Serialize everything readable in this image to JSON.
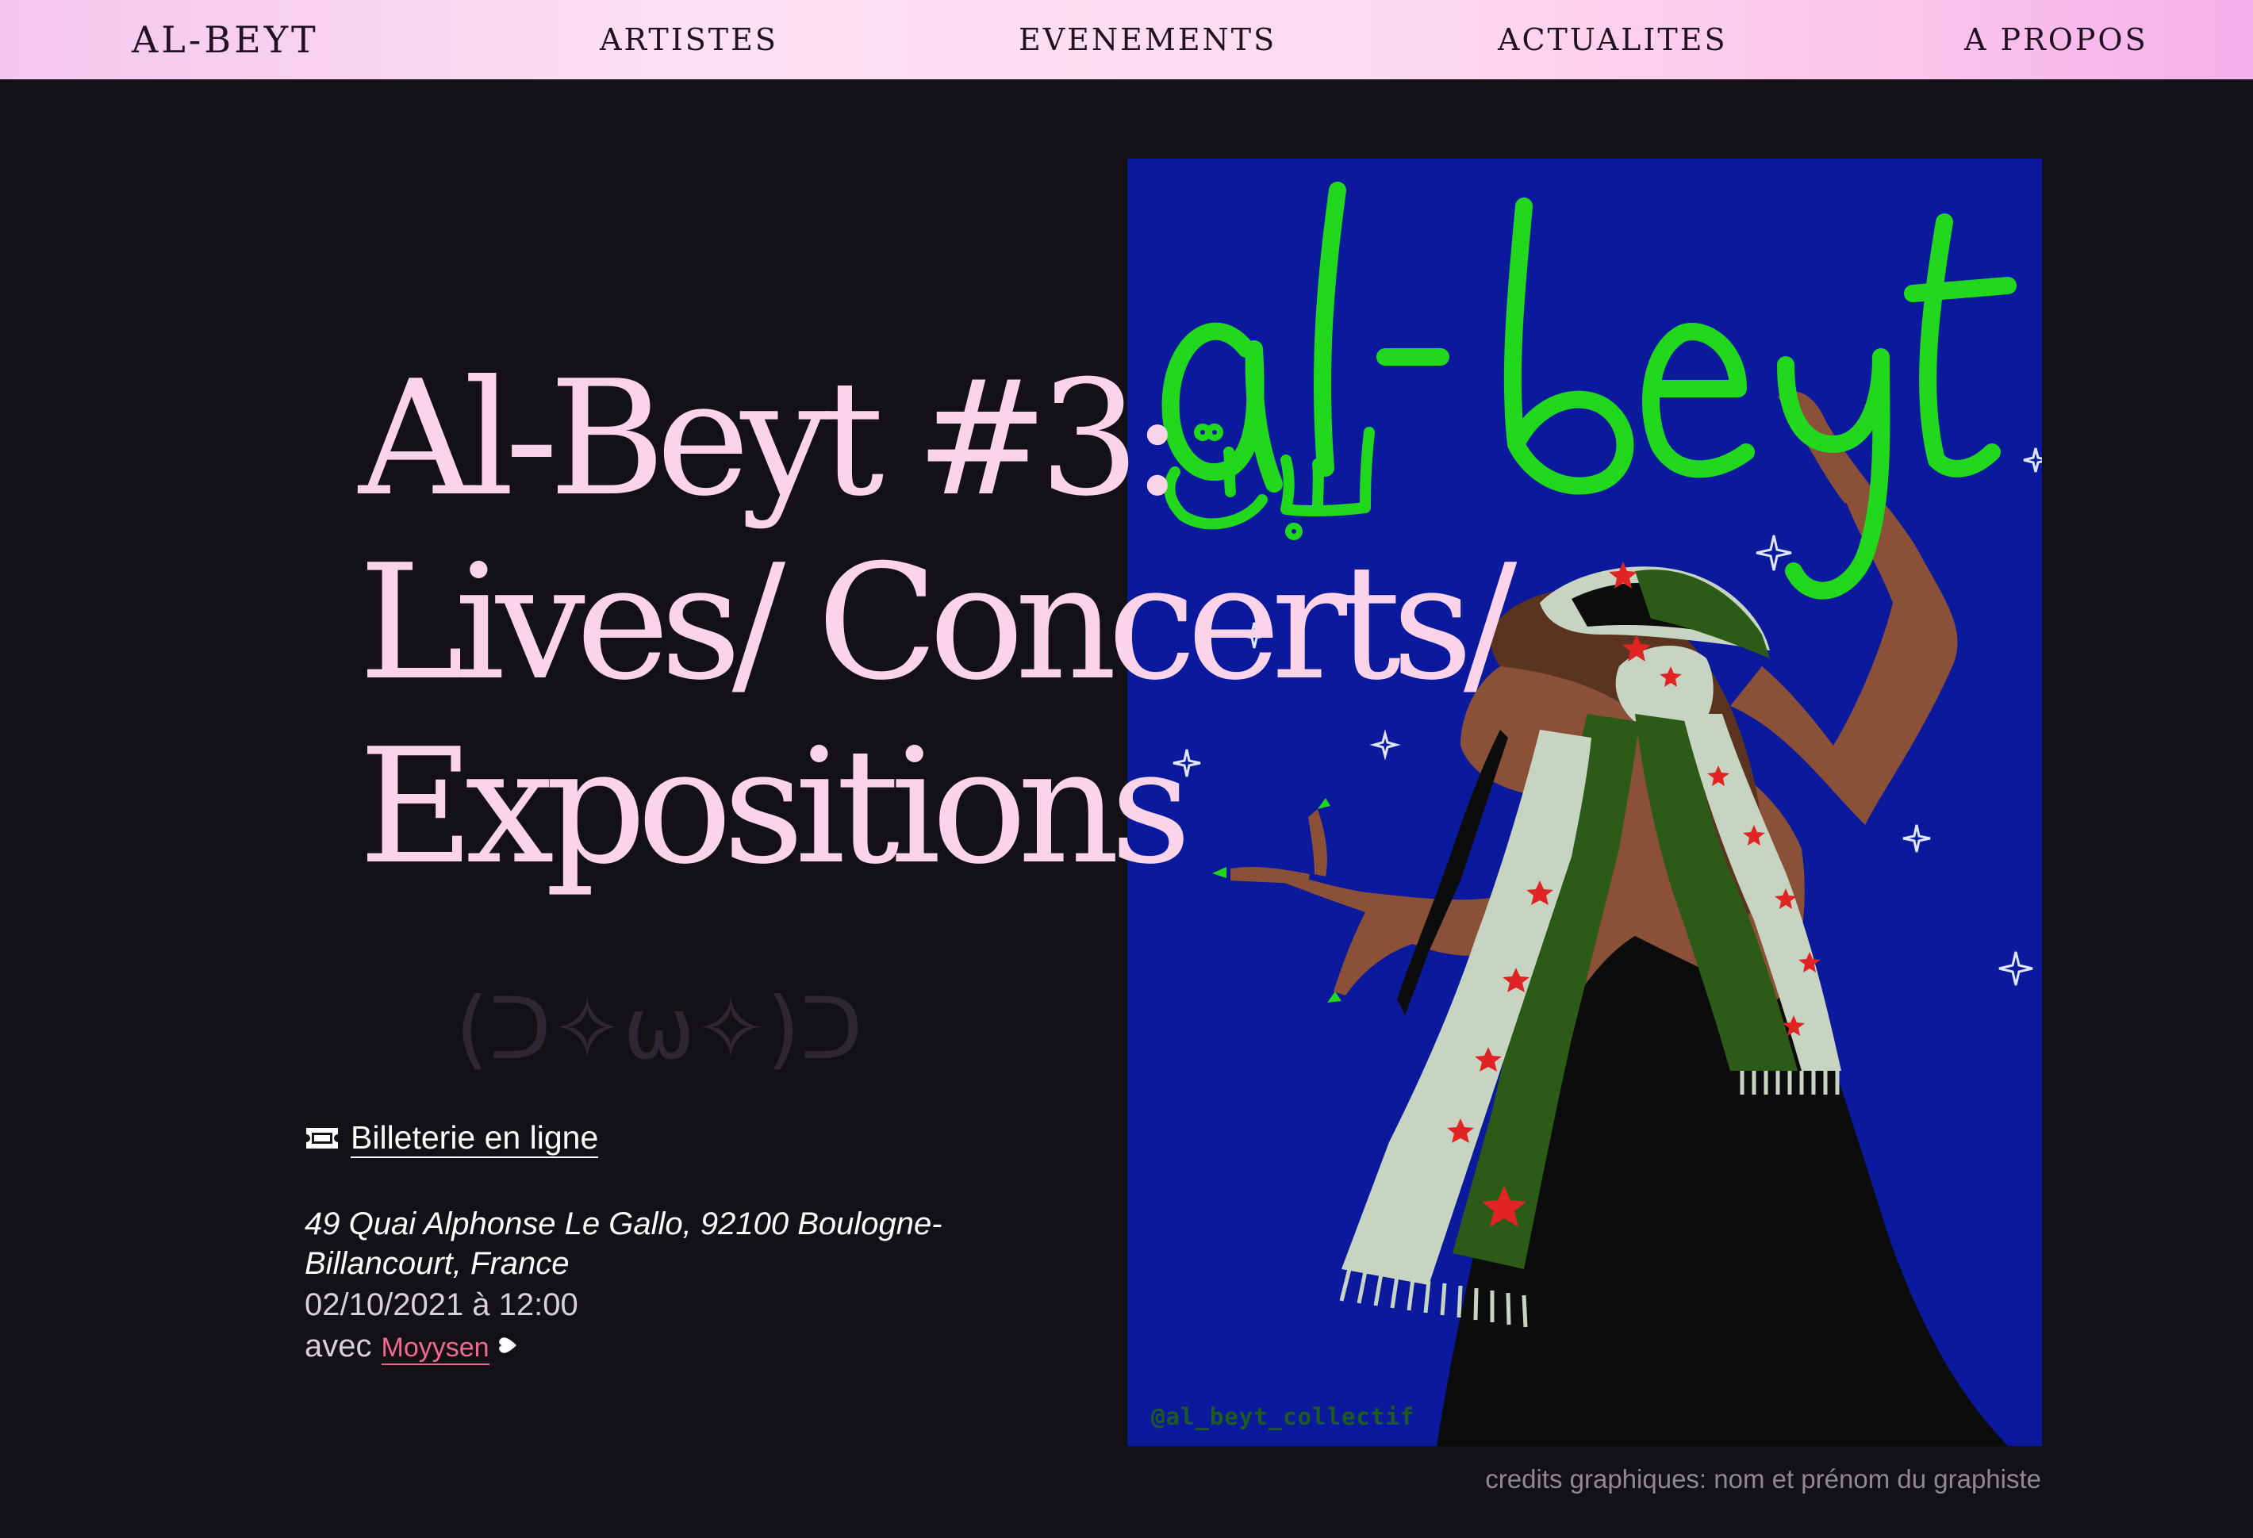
{
  "nav": {
    "logo": "AL-BEYT",
    "items": [
      {
        "label": "ARTISTES"
      },
      {
        "label": "EVENEMENTS"
      },
      {
        "label": "ACTUALITES"
      },
      {
        "label": "A PROPOS"
      }
    ]
  },
  "event": {
    "title_lines": [
      "Al-Beyt #3:",
      "Lives/ Concerts/",
      "Expositions"
    ],
    "kaomoji": "(ᑐ✧ω✧)ᑐ",
    "ticket": {
      "label": "Billeterie en ligne",
      "icon": "ticket-icon"
    },
    "address": "49 Quai Alphonse Le Gallo, 92100 Boulogne-Billancourt, France",
    "datetime": "02/10/2021 à 12:00",
    "with_label": "avec",
    "artist": "Moyysen",
    "artist_icon": "heart-icon"
  },
  "poster": {
    "title_latin": "al-beyt",
    "title_arabic": "البيت",
    "handle": "@al_beyt_collectif",
    "colors": {
      "background": "#0b1a9c",
      "lettering": "#22d81c",
      "skin": "#8a5038",
      "dress": "#0c0c0c",
      "scarf_green": "#2c5a17",
      "scarf_white": "#c8d4c2",
      "star": "#e02424"
    }
  },
  "credits": "credits graphiques: nom et prénom du graphiste",
  "colors": {
    "page_bg": "#141116",
    "title": "#fcd4ea",
    "link_accent": "#ee6b8e",
    "nav_gradient_start": "#f3c6ef",
    "nav_gradient_end": "#f6b1ea"
  }
}
